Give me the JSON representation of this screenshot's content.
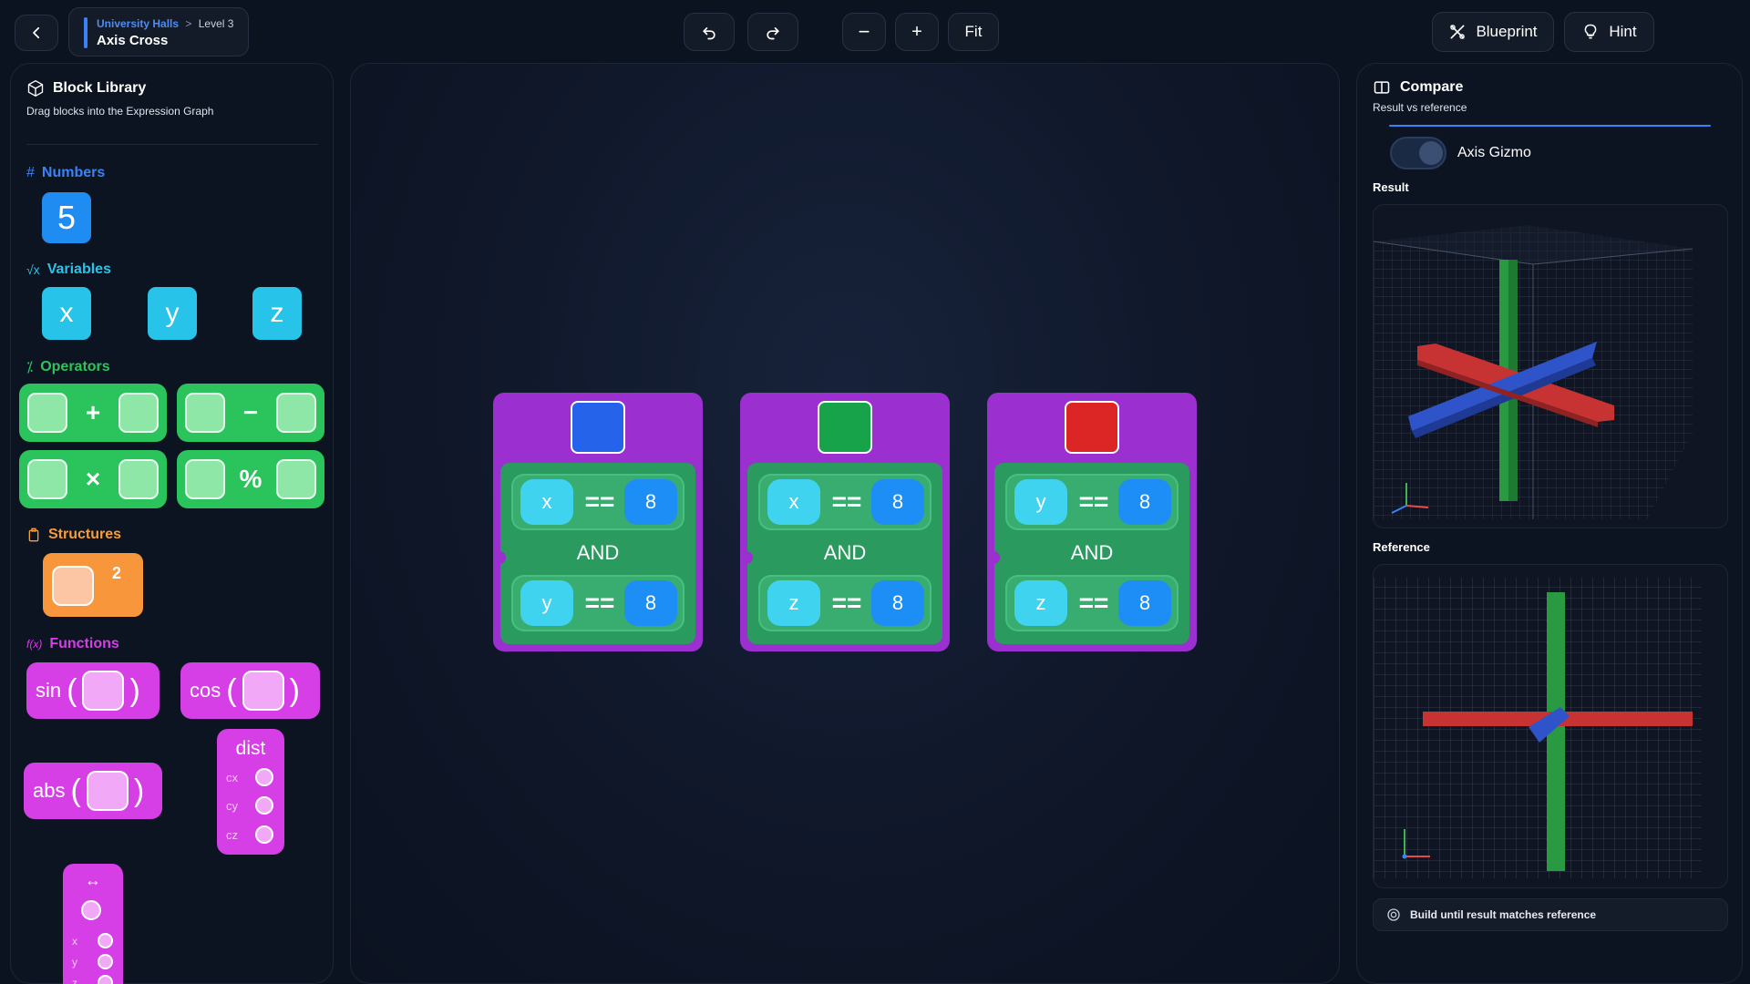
{
  "header": {
    "breadcrumb_parent": "University Halls",
    "breadcrumb_level": "Level 3",
    "title": "Axis Cross",
    "zoom_out_label": "−",
    "zoom_in_label": "+",
    "fit_label": "Fit",
    "blueprint_label": "Blueprint",
    "hint_label": "Hint"
  },
  "library": {
    "title": "Block Library",
    "subtitle": "Drag blocks into the Expression Graph",
    "numbers": {
      "title": "Numbers",
      "icon": "#",
      "value": "5"
    },
    "variables": {
      "title": "Variables",
      "icon": "√x",
      "items": [
        "x",
        "y",
        "z"
      ]
    },
    "operators": {
      "title": "Operators",
      "icon": "⁒",
      "items": [
        "+",
        "−",
        "×",
        "%"
      ]
    },
    "structures": {
      "title": "Structures",
      "superscript": "2"
    },
    "functions": {
      "title": "Functions",
      "icon": "f(x)",
      "sin": "sin",
      "cos": "cos",
      "abs": "abs",
      "dist": {
        "label": "dist",
        "params": [
          "cx",
          "cy",
          "cz"
        ]
      },
      "rotate": {
        "arrow": "↔",
        "params": [
          "x",
          "y",
          "z"
        ]
      }
    }
  },
  "graph": {
    "and_label": "AND",
    "cards": [
      {
        "color": "#2563eb",
        "rows": [
          {
            "var": "x",
            "op": "==",
            "val": "8"
          },
          {
            "var": "y",
            "op": "==",
            "val": "8"
          }
        ]
      },
      {
        "color": "#16a34a",
        "rows": [
          {
            "var": "x",
            "op": "==",
            "val": "8"
          },
          {
            "var": "z",
            "op": "==",
            "val": "8"
          }
        ]
      },
      {
        "color": "#dc2626",
        "rows": [
          {
            "var": "y",
            "op": "==",
            "val": "8"
          },
          {
            "var": "z",
            "op": "==",
            "val": "8"
          }
        ]
      }
    ]
  },
  "compare": {
    "title": "Compare",
    "subtitle": "Result vs reference",
    "toggle_label": "Axis Gizmo",
    "result_label": "Result",
    "reference_label": "Reference",
    "status": "Build until result matches reference"
  },
  "colors": {
    "accent_blue": "#3b82f6",
    "numbers": "#3b82f6",
    "variables": "#28c3e8",
    "operators": "#2bc45c",
    "structures": "#f59e3b",
    "functions": "#d63ee6"
  }
}
